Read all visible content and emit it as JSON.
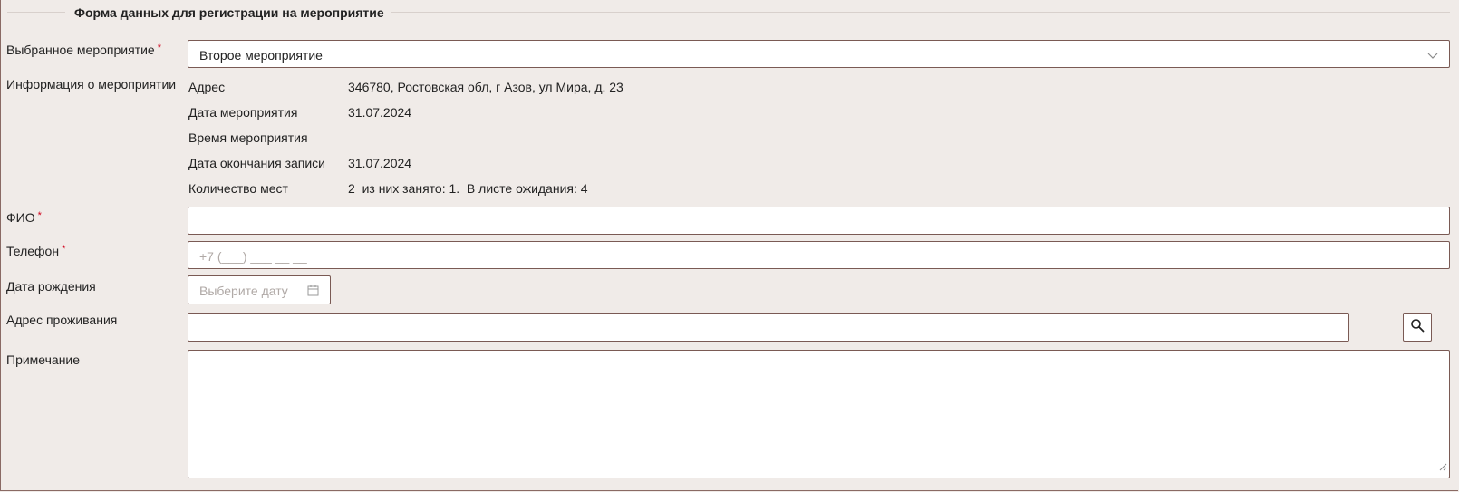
{
  "form": {
    "legend": "Форма данных для регистрации на мероприятие"
  },
  "event_select": {
    "label": "Выбранное мероприятие",
    "required_mark": "*",
    "value": "Второе мероприятие"
  },
  "event_info": {
    "label": "Информация о мероприятии",
    "rows": [
      {
        "key": "Адрес",
        "value": "346780, Ростовская обл, г Азов, ул Мира, д. 23"
      },
      {
        "key": "Дата мероприятия",
        "value": "31.07.2024"
      },
      {
        "key": "Время мероприятия",
        "value": ""
      },
      {
        "key": "Дата окончания записи",
        "value": "31.07.2024"
      },
      {
        "key": "Количество мест",
        "value": "2  из них занято: 1.  В листе ожидания: 4"
      }
    ]
  },
  "fio": {
    "label": "ФИО",
    "required_mark": "*",
    "value": ""
  },
  "phone": {
    "label": "Телефон",
    "required_mark": "*",
    "placeholder": "+7 (___) ___ __ __"
  },
  "birthdate": {
    "label": "Дата рождения",
    "placeholder": "Выберите дату"
  },
  "address": {
    "label": "Адрес проживания",
    "value": ""
  },
  "note": {
    "label": "Примечание",
    "value": ""
  },
  "icons": {
    "select_arrow": "chevron-down-icon",
    "date_picker": "calendar-icon",
    "address_search": "search-icon",
    "textarea_resize": "resize-handle-icon"
  }
}
